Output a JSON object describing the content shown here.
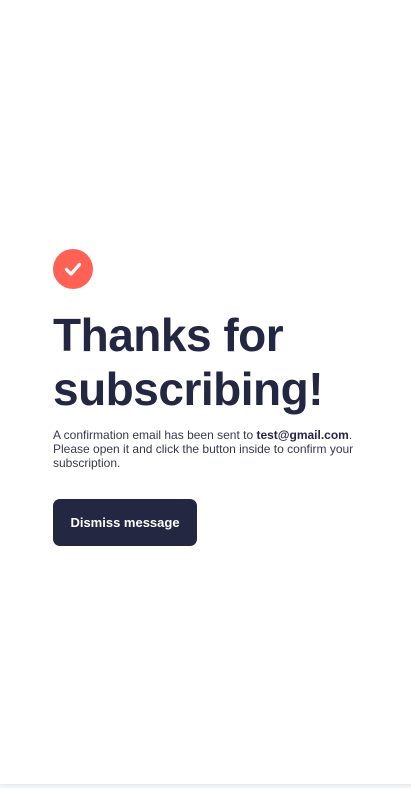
{
  "colors": {
    "accent": "#ff6155",
    "dark_navy": "#242742",
    "text": "#36384e",
    "background": "#ffffff"
  },
  "icon": {
    "name": "check-circle-icon"
  },
  "page": {
    "title": "Thanks for subscribing!",
    "message_prefix": "A confirmation email has been sent to ",
    "email": "test@gmail.com",
    "message_suffix": ". Please open it and click the button inside to confirm your subscription."
  },
  "actions": {
    "dismiss_label": "Dismiss message"
  }
}
